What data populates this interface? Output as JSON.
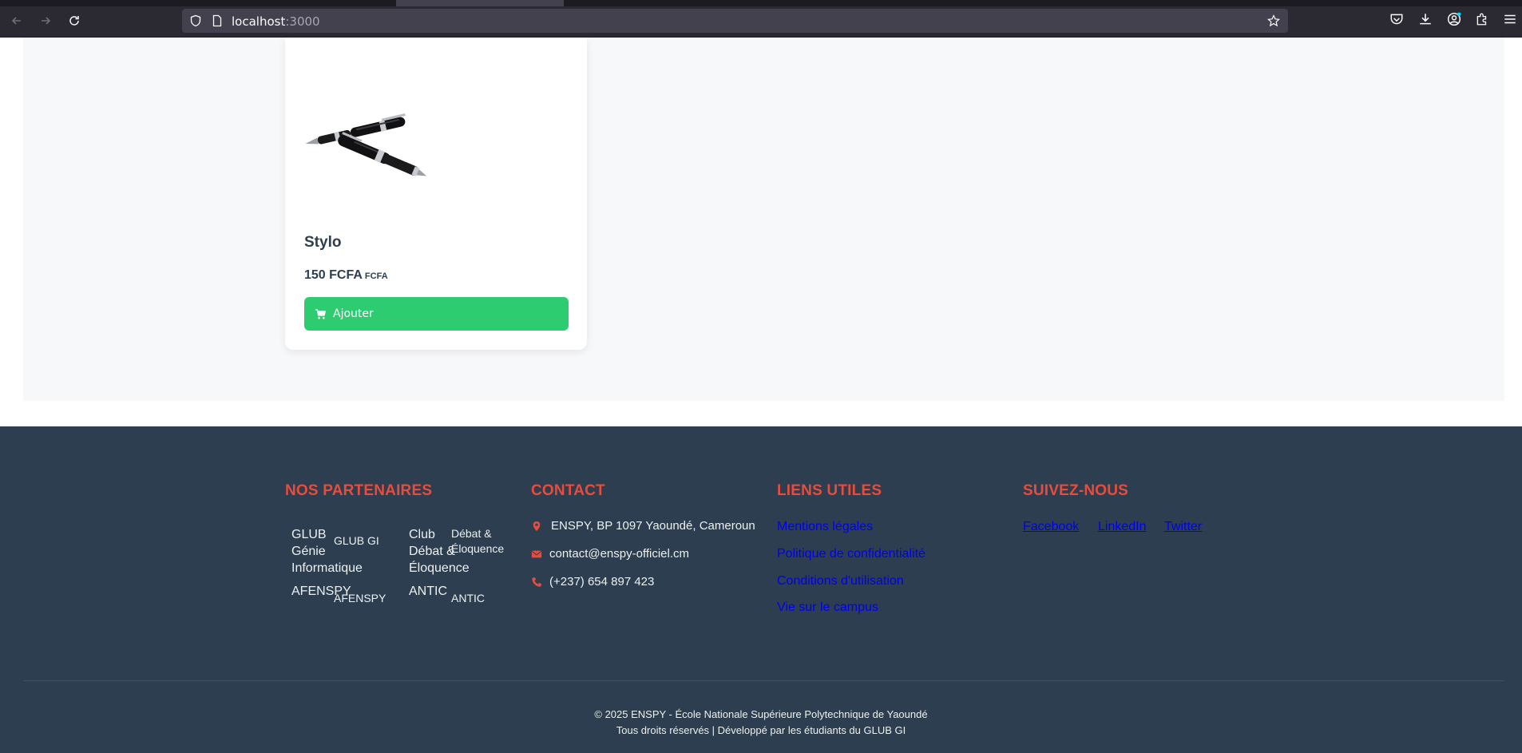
{
  "browser": {
    "url_host": "localhost",
    "url_port": ":3000"
  },
  "product": {
    "name": "Stylo",
    "price": "150 FCFA",
    "currency": "FCFA",
    "add_label": "Ajouter"
  },
  "footer": {
    "partners_title": "NOS PARTENAIRES",
    "partners": {
      "glub_big": "GLUB Génie Informatique",
      "glub_small": "GLUB GI",
      "club_big": "Club Débat & Éloquence",
      "club_small": "Débat & Éloquence",
      "afenspy_big": "AFENSPY",
      "afenspy_small": "AFENSPY",
      "antic_big": "ANTIC",
      "antic_small": "ANTIC"
    },
    "contact_title": "CONTACT",
    "contact": {
      "address": "ENSPY, BP 1097 Yaoundé, Cameroun",
      "email": "contact@enspy-officiel.cm",
      "phone": "(+237) 654 897 423"
    },
    "links_title": "LIENS UTILES",
    "links": [
      "Mentions légales",
      "Politique de confidentialité",
      "Conditions d'utilisation",
      "Vie sur le campus"
    ],
    "social_title": "SUIVEZ-NOUS",
    "social": [
      "Facebook",
      "LinkedIn",
      "Twitter"
    ],
    "copyright_line1": "© 2025 ENSPY - École Nationale Supérieure Polytechnique de Yaoundé",
    "copyright_line2": "Tous droits réservés | Développé par les étudiants du GLUB GI"
  },
  "colors": {
    "accent_red": "#e74c3c",
    "button_green": "#2ecc71",
    "footer_bg": "#2c3e50"
  }
}
